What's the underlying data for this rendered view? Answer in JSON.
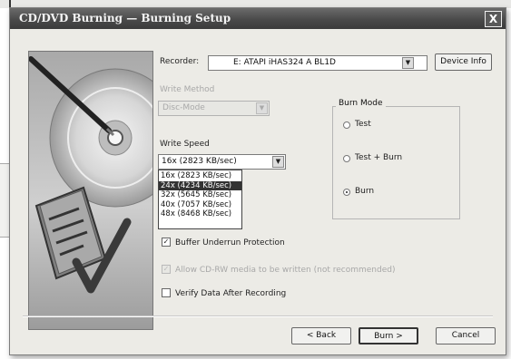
{
  "dialog": {
    "title": "CD/DVD Burning — Burning Setup",
    "close_label": "X"
  },
  "recorder": {
    "label": "Recorder:",
    "value": "E: ATAPI   iHAS324   A    BL1D",
    "device_info_label": "Device Info"
  },
  "write_method": {
    "label": "Write Method",
    "value": "Disc-Mode"
  },
  "write_speed": {
    "label": "Write Speed",
    "value": "16x  (2823 KB/sec)",
    "options": [
      "16x  (2823 KB/sec)",
      "24x  (4234 KB/sec)",
      "32x  (5645 KB/sec)",
      "40x  (7057 KB/sec)",
      "48x  (8468 KB/sec)"
    ],
    "selected_index": 1
  },
  "burn_mode": {
    "label": "Burn Mode",
    "options": [
      "Test",
      "Test + Burn",
      "Burn"
    ],
    "selected_index": 2
  },
  "options": {
    "buffer_underrun": {
      "label": "Buffer Underrun Protection",
      "checked": true
    },
    "disc_option": {
      "label": "Allow CD-RW media to be written (not recommended)",
      "checked": true,
      "disabled": true
    },
    "verify": {
      "label": "Verify Data After Recording",
      "checked": false
    }
  },
  "buttons": {
    "back": "< Back",
    "burn": "Burn >",
    "cancel": "Cancel"
  },
  "colors": {
    "titlebar": "#4a4a4a",
    "dialog_bg": "#ecebe6",
    "selection": "#333333"
  }
}
